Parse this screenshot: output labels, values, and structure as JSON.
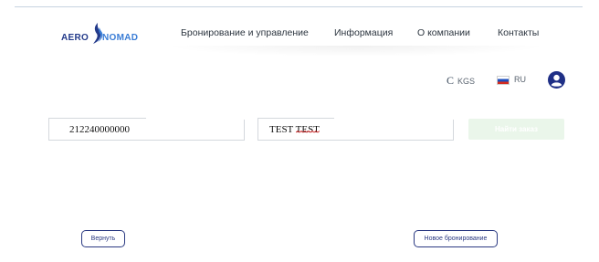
{
  "logo": {
    "part1": "AERO",
    "part2": "NOMAD"
  },
  "nav": {
    "items": [
      {
        "label": "Бронирование и управление"
      },
      {
        "label": "Информация"
      },
      {
        "label": "О компании"
      },
      {
        "label": "Контакты"
      }
    ]
  },
  "settings": {
    "currency_symbol": "С",
    "currency": "KGS",
    "language": "RU"
  },
  "search": {
    "booking_number": "212240000000",
    "passenger_name": "TEST TEST",
    "find_label": "Найти заказ"
  },
  "actions": {
    "back_label": "Вернуть",
    "new_booking_label": "Новое бронирование"
  },
  "colors": {
    "brand_dark": "#233a8a",
    "brand_light": "#3a7dd6",
    "find_button_bg": "#eaf6ea",
    "outline": "#2b3a82"
  }
}
